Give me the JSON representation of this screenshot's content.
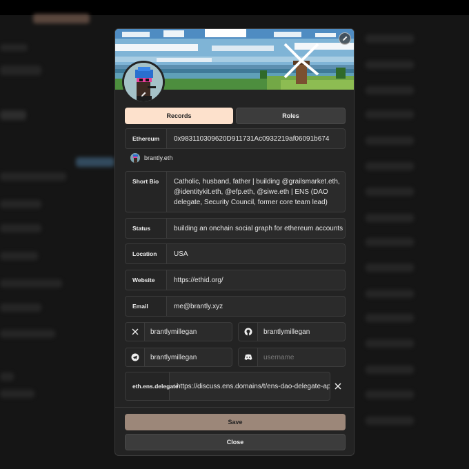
{
  "tabs": {
    "records": "Records",
    "roles": "Roles"
  },
  "records": {
    "ethereum": {
      "label": "Ethereum",
      "value": "0x983110309620D911731Ac0932219af06091b674"
    },
    "ens_name": "brantly.eth",
    "short_bio": {
      "label": "Short Bio",
      "value": "Catholic, husband, father | building @grailsmarket.eth, @identitykit.eth, @efp.eth, @siwe.eth | ENS (DAO delegate, Security Council, former core team lead)"
    },
    "status": {
      "label": "Status",
      "value": "building an onchain social graph for ethereum accounts"
    },
    "location": {
      "label": "Location",
      "value": "USA"
    },
    "website": {
      "label": "Website",
      "value": "https://ethid.org/"
    },
    "email": {
      "label": "Email",
      "value": "me@brantly.xyz"
    }
  },
  "social": {
    "x": {
      "icon": "x-icon",
      "value": "brantlymillegan"
    },
    "github": {
      "icon": "github-icon",
      "value": "brantlymillegan"
    },
    "telegram": {
      "icon": "telegram-icon",
      "value": "brantlymillegan"
    },
    "discord": {
      "icon": "discord-icon",
      "placeholder": "username"
    }
  },
  "custom": {
    "label": "eth.ens.delegate",
    "value": "https://discuss.ens.domains/t/ens-dao-delegate-applications"
  },
  "buttons": {
    "save": "Save",
    "close": "Close"
  },
  "colors": {
    "accent": "#fde1cc",
    "save": "#9c8779",
    "panel": "#232323"
  }
}
